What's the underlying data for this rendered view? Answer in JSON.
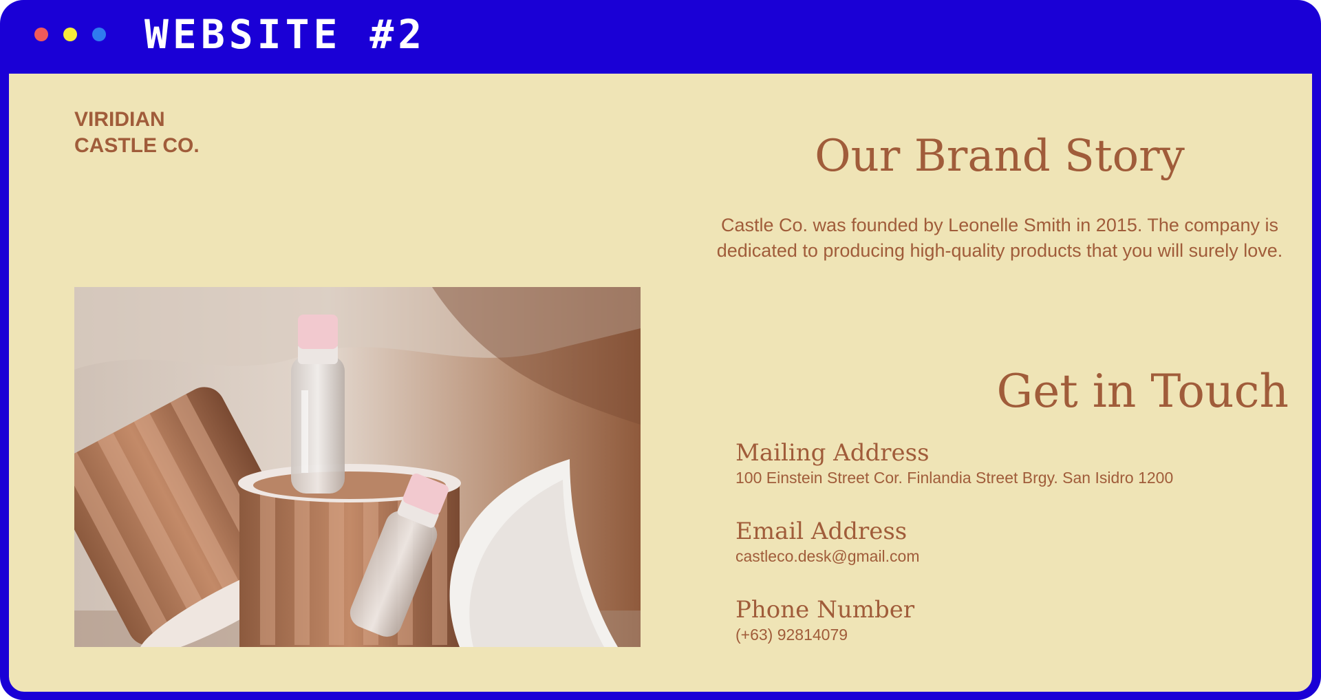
{
  "window": {
    "title": "WEBSITE #2",
    "controls": [
      "close-dot",
      "minimize-dot",
      "maximize-dot"
    ]
  },
  "site": {
    "logo_line1": "VIRIDIAN",
    "logo_line2": "CASTLE CO."
  },
  "brand_story": {
    "heading": "Our Brand Story",
    "body": "Castle Co. was founded by Leonelle Smith in 2015. The company is dedicated to producing high-quality products that you will surely love."
  },
  "contact": {
    "heading": "Get in Touch",
    "mailing_label": "Mailing Address",
    "mailing_value": "100 Einstein Street Cor. Finlandia Street Brgy. San Isidro 1200",
    "email_label": "Email Address",
    "email_value": "castleco.desk@gmail.com",
    "phone_label": "Phone Number",
    "phone_value": "(+63) 92814079"
  },
  "colors": {
    "frame": "#1a00d6",
    "background": "#efe4b6",
    "text": "#a05c3a",
    "dot_red": "#f05a5a",
    "dot_yellow": "#f6ec3a",
    "dot_blue": "#2f7bef"
  }
}
